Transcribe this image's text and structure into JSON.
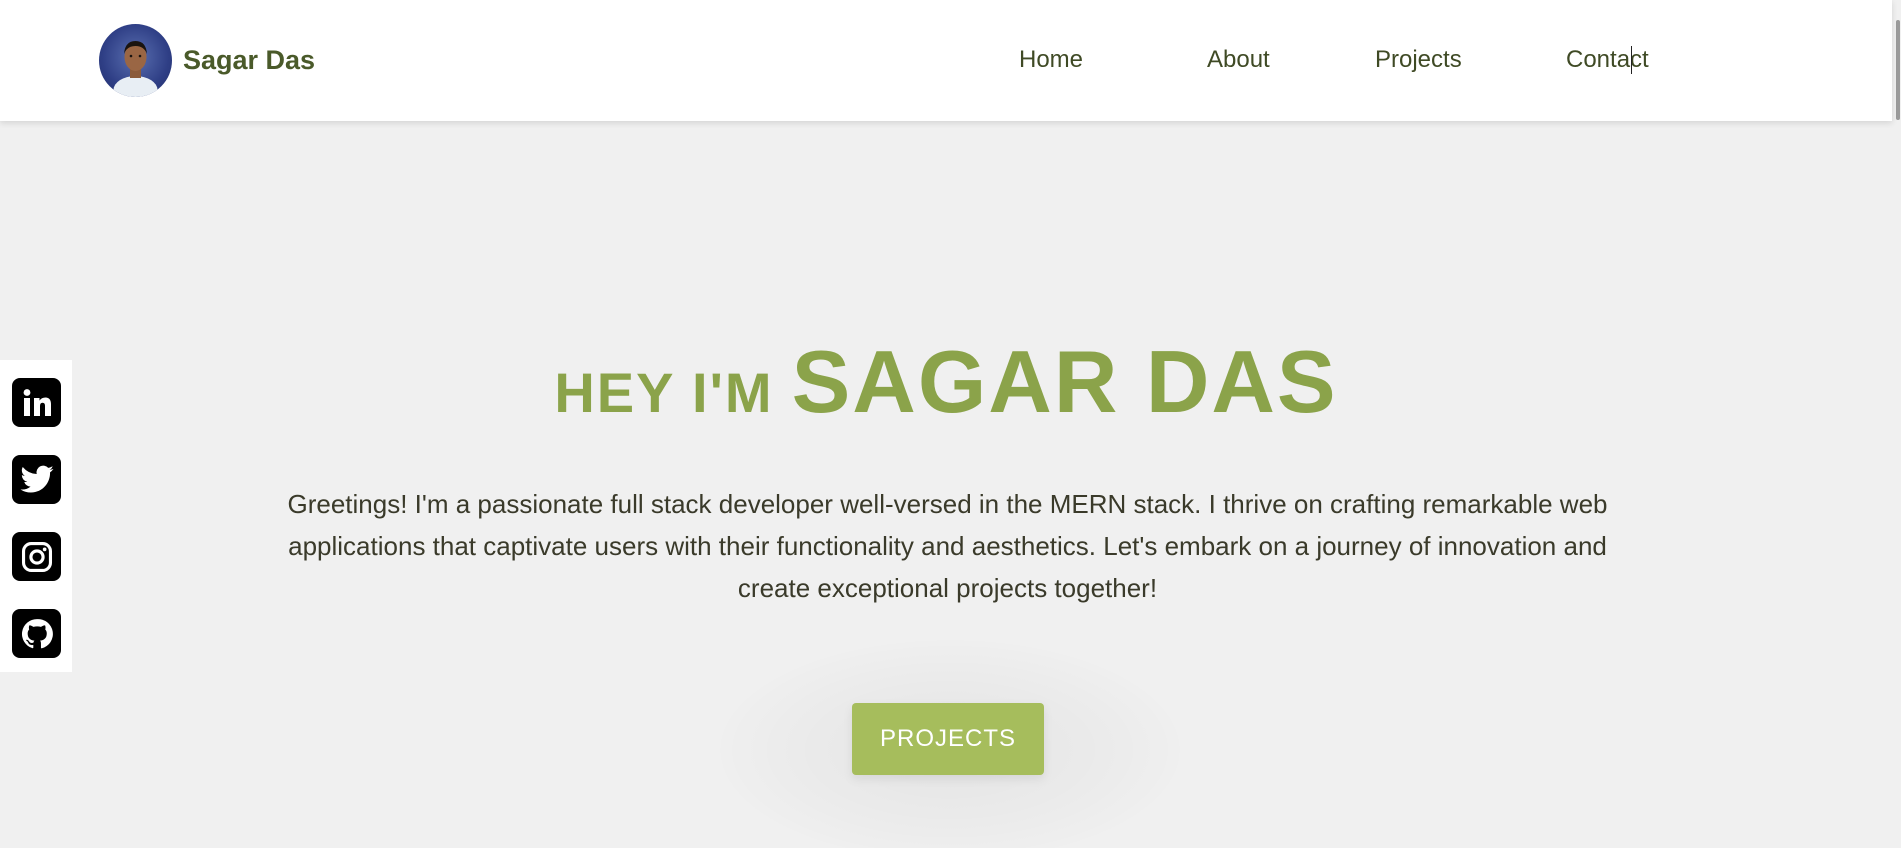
{
  "header": {
    "brand_name": "Sagar Das",
    "nav": [
      {
        "label": "Home"
      },
      {
        "label": "About"
      },
      {
        "label": "Projects"
      },
      {
        "label": "Contact"
      }
    ]
  },
  "social": {
    "items": [
      {
        "icon": "linkedin-icon"
      },
      {
        "icon": "twitter-icon"
      },
      {
        "icon": "instagram-icon"
      },
      {
        "icon": "github-icon"
      }
    ]
  },
  "hero": {
    "greeting": "HEY I'M",
    "name": "SAGAR DAS",
    "description": "Greetings! I'm a passionate full stack developer well-versed in the MERN stack. I thrive on crafting remarkable web applications that captivate users with their functionality and aesthetics. Let's embark on a journey of innovation and create exceptional projects together!",
    "button_label": "PROJECTS"
  },
  "colors": {
    "accent": "#8ba34a",
    "button": "#a6bd5c",
    "brand_text": "#4a5a2a",
    "background": "#f0f0f0"
  }
}
